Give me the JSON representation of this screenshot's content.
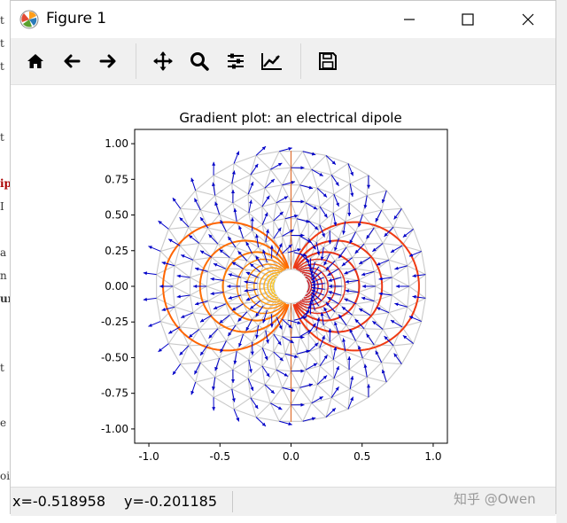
{
  "window": {
    "title": "Figure 1"
  },
  "edge_fragments": [
    "t",
    "t",
    "t",
    "t",
    "ip",
    "I",
    "a",
    "n",
    "ur",
    "t",
    "e",
    "oi"
  ],
  "toolbar": {
    "tools": [
      {
        "name": "home-icon",
        "label": "home"
      },
      {
        "name": "back-icon",
        "label": "back"
      },
      {
        "name": "forward-icon",
        "label": "forward"
      },
      {
        "name": "pan-icon",
        "label": "pan"
      },
      {
        "name": "zoom-icon",
        "label": "zoom"
      },
      {
        "name": "configure-subplots-icon",
        "label": "subplots"
      },
      {
        "name": "edit-axis-icon",
        "label": "customize"
      },
      {
        "name": "save-icon",
        "label": "save"
      }
    ]
  },
  "status": {
    "x_readout": "x=-0.518958",
    "y_readout": "y=-0.201185"
  },
  "watermark": "知乎 @Owen",
  "colors": {
    "mesh": "#c9c9c9",
    "arrows": "#0000c8",
    "contour_low": "#ffe000",
    "contour_high": "#cc0000"
  },
  "chart_data": {
    "type": "quiver",
    "title": "Gradient plot: an electrical dipole",
    "xlabel": "",
    "ylabel": "",
    "xlim": [
      -1.1,
      1.1
    ],
    "ylim": [
      -1.1,
      1.1
    ],
    "x_ticks": [
      "-1.0",
      "-0.5",
      "0.0",
      "0.5",
      "1.0"
    ],
    "x_tick_values": [
      -1.0,
      -0.5,
      0.0,
      0.5,
      1.0
    ],
    "y_ticks": [
      "1.00",
      "0.75",
      "0.50",
      "0.25",
      "0.00",
      "-0.25",
      "-0.50",
      "-0.75",
      "-1.00"
    ],
    "y_tick_values": [
      1.0,
      0.75,
      0.5,
      0.25,
      0.0,
      -0.25,
      -0.5,
      -0.75,
      -1.0
    ],
    "mesh": {
      "inner_radius": 0.12,
      "outer_radius": 0.95,
      "n_radii": 8,
      "n_angles": 36
    },
    "dipole": {
      "charges": [
        {
          "x": -0.03,
          "y": 0.0,
          "q": 1
        },
        {
          "x": 0.03,
          "y": 0.0,
          "q": -1
        }
      ]
    },
    "grid": false,
    "legend": "none"
  }
}
